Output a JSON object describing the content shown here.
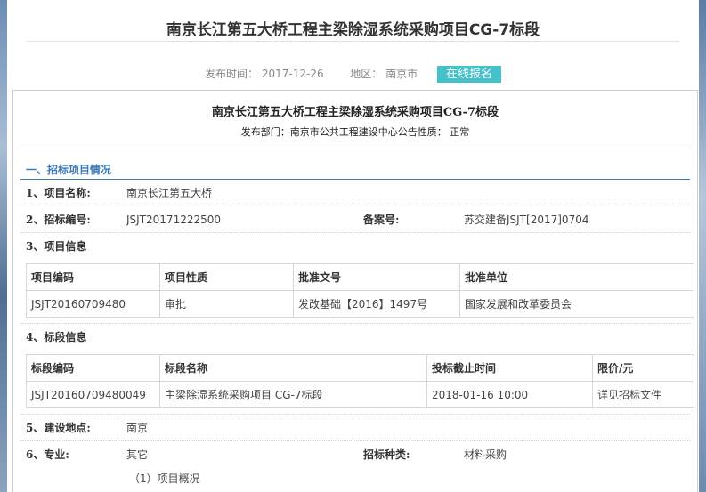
{
  "page": {
    "title": "南京长江第五大桥工程主梁除湿系统采购项目CG-7标段",
    "publish_label": "发布时间：",
    "publish_date": "2017-12-26",
    "region_label": "地区：",
    "region": "南京市",
    "signup_button": "在线报名"
  },
  "doc": {
    "title": "南京长江第五大桥工程主梁除湿系统采购项目CG-7标段",
    "subtitle": "发布部门：南京市公共工程建设中心公告性质：  正常"
  },
  "section1": {
    "heading": "一、招标项目情况",
    "project_name_label": "1、项目名称:",
    "project_name": "南京长江第五大桥",
    "tender_no_label": "2、招标编号:",
    "tender_no": "JSJT20171222500",
    "record_no_label": "备案号:",
    "record_no": "苏交建备JSJT[2017]0704",
    "project_info_label": "3、项目信息",
    "project_table": {
      "headers": [
        "项目编码",
        "项目性质",
        "批准文号",
        "批准单位"
      ],
      "rows": [
        [
          "JSJT20160709480",
          "审批",
          "发改基础【2016】1497号",
          "国家发展和改革委员会"
        ]
      ]
    },
    "section_info_label": "4、标段信息",
    "section_table": {
      "headers": [
        "标段编码",
        "标段名称",
        "投标截止时间",
        "限价/元"
      ],
      "rows": [
        [
          "JSJT20160709480049",
          "主梁除湿系统采购项目 CG-7标段",
          "2018-01-16 10:00",
          "详见招标文件"
        ]
      ]
    },
    "location_label": "5、建设地点:",
    "location": "南京",
    "specialty_label": "6、专业:",
    "specialty": "其它",
    "tender_type_label": "招标种类:",
    "tender_type": "材料采购",
    "overview": "（1）项目概况"
  }
}
